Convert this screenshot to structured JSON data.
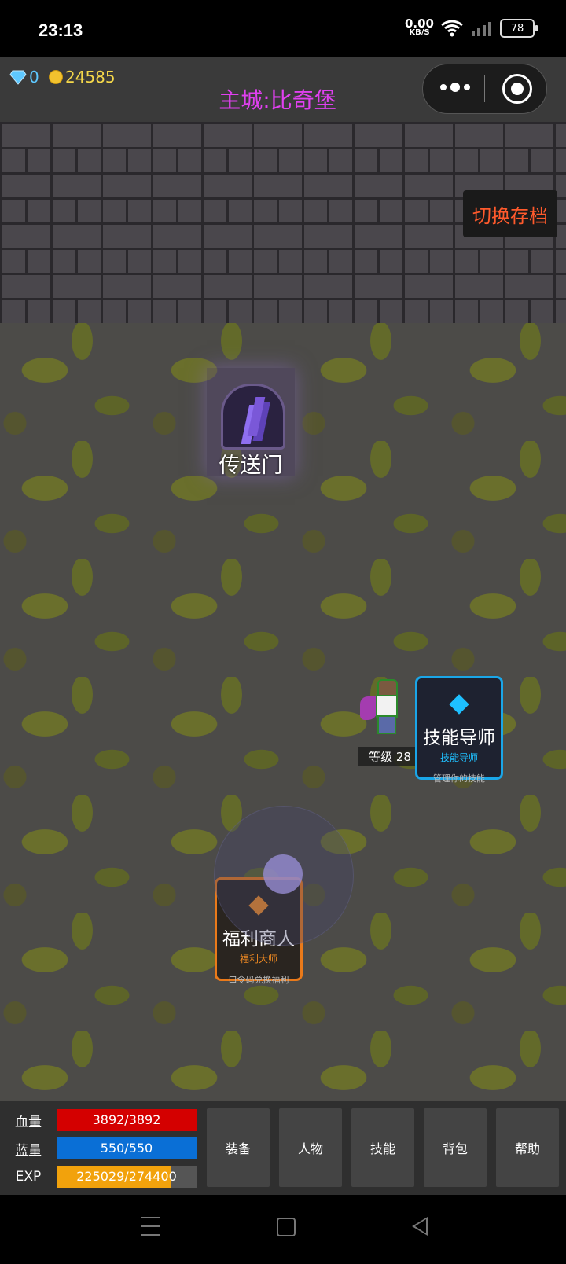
{
  "status_bar": {
    "time": "23:13",
    "net_speed": "0.00",
    "net_unit": "KB/S",
    "battery": "78"
  },
  "header": {
    "gems": "0",
    "coins": "24585",
    "title": "主城:比奇堡"
  },
  "switch_save_label": "切换存档",
  "portal_label": "传送门",
  "player": {
    "level_label": "等级 28"
  },
  "npcs": {
    "skill": {
      "name": "技能导师",
      "subtitle": "技能导师",
      "description": "管理你的技能"
    },
    "welfare": {
      "name": "福利商人",
      "subtitle": "福利大师",
      "description": "口令码兑换福利"
    }
  },
  "stats": {
    "hp": {
      "label": "血量",
      "value": "3892/3892",
      "fraction": 1.0,
      "color": "#d40000"
    },
    "mp": {
      "label": "蓝量",
      "value": "550/550",
      "fraction": 1.0,
      "color": "#0a6fd6"
    },
    "exp": {
      "label": "EXP",
      "value": "225029/274400",
      "fraction": 0.82,
      "color": "#f2a20c"
    }
  },
  "menu": [
    "装备",
    "人物",
    "技能",
    "背包",
    "帮助"
  ]
}
